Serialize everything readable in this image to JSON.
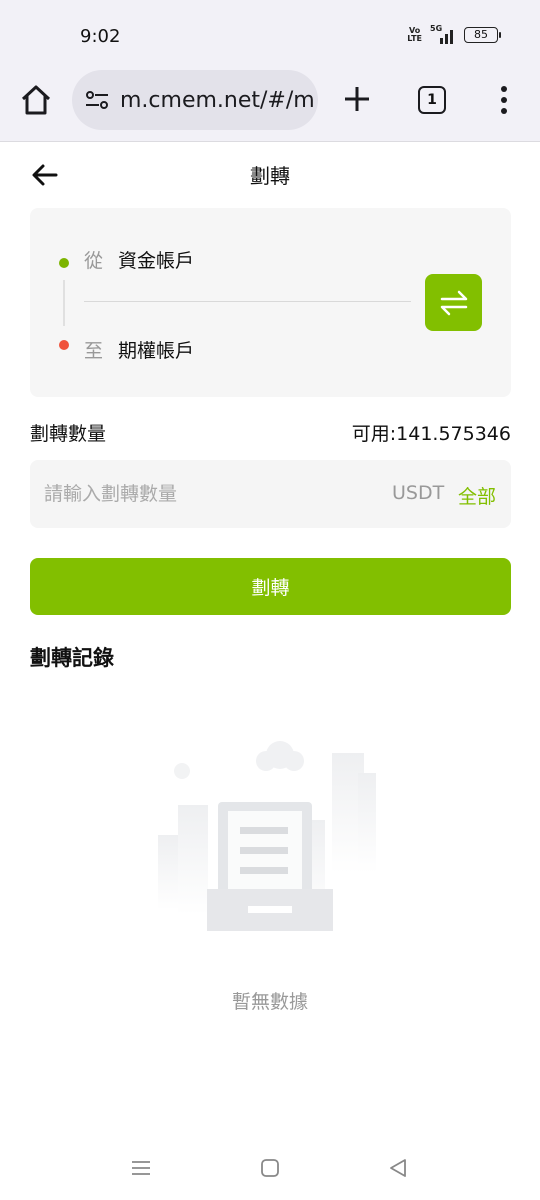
{
  "status_bar": {
    "time": "9:02",
    "volte": "Vo LTE",
    "network": "5G",
    "battery": "85"
  },
  "browser": {
    "url": "m.cmem.net/#/m",
    "tab_count": "1",
    "icons": [
      "home-icon",
      "tune-icon",
      "plus-icon",
      "tabs-icon",
      "more-vert-icon"
    ]
  },
  "header": {
    "title": "劃轉",
    "back_icon": "arrow-left-icon"
  },
  "transfer": {
    "from_label": "從",
    "from_value": "資金帳戶",
    "to_label": "至",
    "to_value": "期權帳戶",
    "swap_icon": "swap-arrows-icon"
  },
  "amount": {
    "title": "劃轉數量",
    "available": "可用:141.575346",
    "placeholder": "請輸入劃轉數量",
    "unit": "USDT",
    "all_label": "全部"
  },
  "submit_label": "劃轉",
  "records": {
    "title": "劃轉記錄",
    "empty_text": "暫無數據"
  },
  "colors": {
    "accent": "#82bf00",
    "from_dot": "#7cb400",
    "to_dot": "#f0523b"
  },
  "nav": {
    "icons": [
      "recents-icon",
      "home-square-icon",
      "back-triangle-icon"
    ]
  }
}
